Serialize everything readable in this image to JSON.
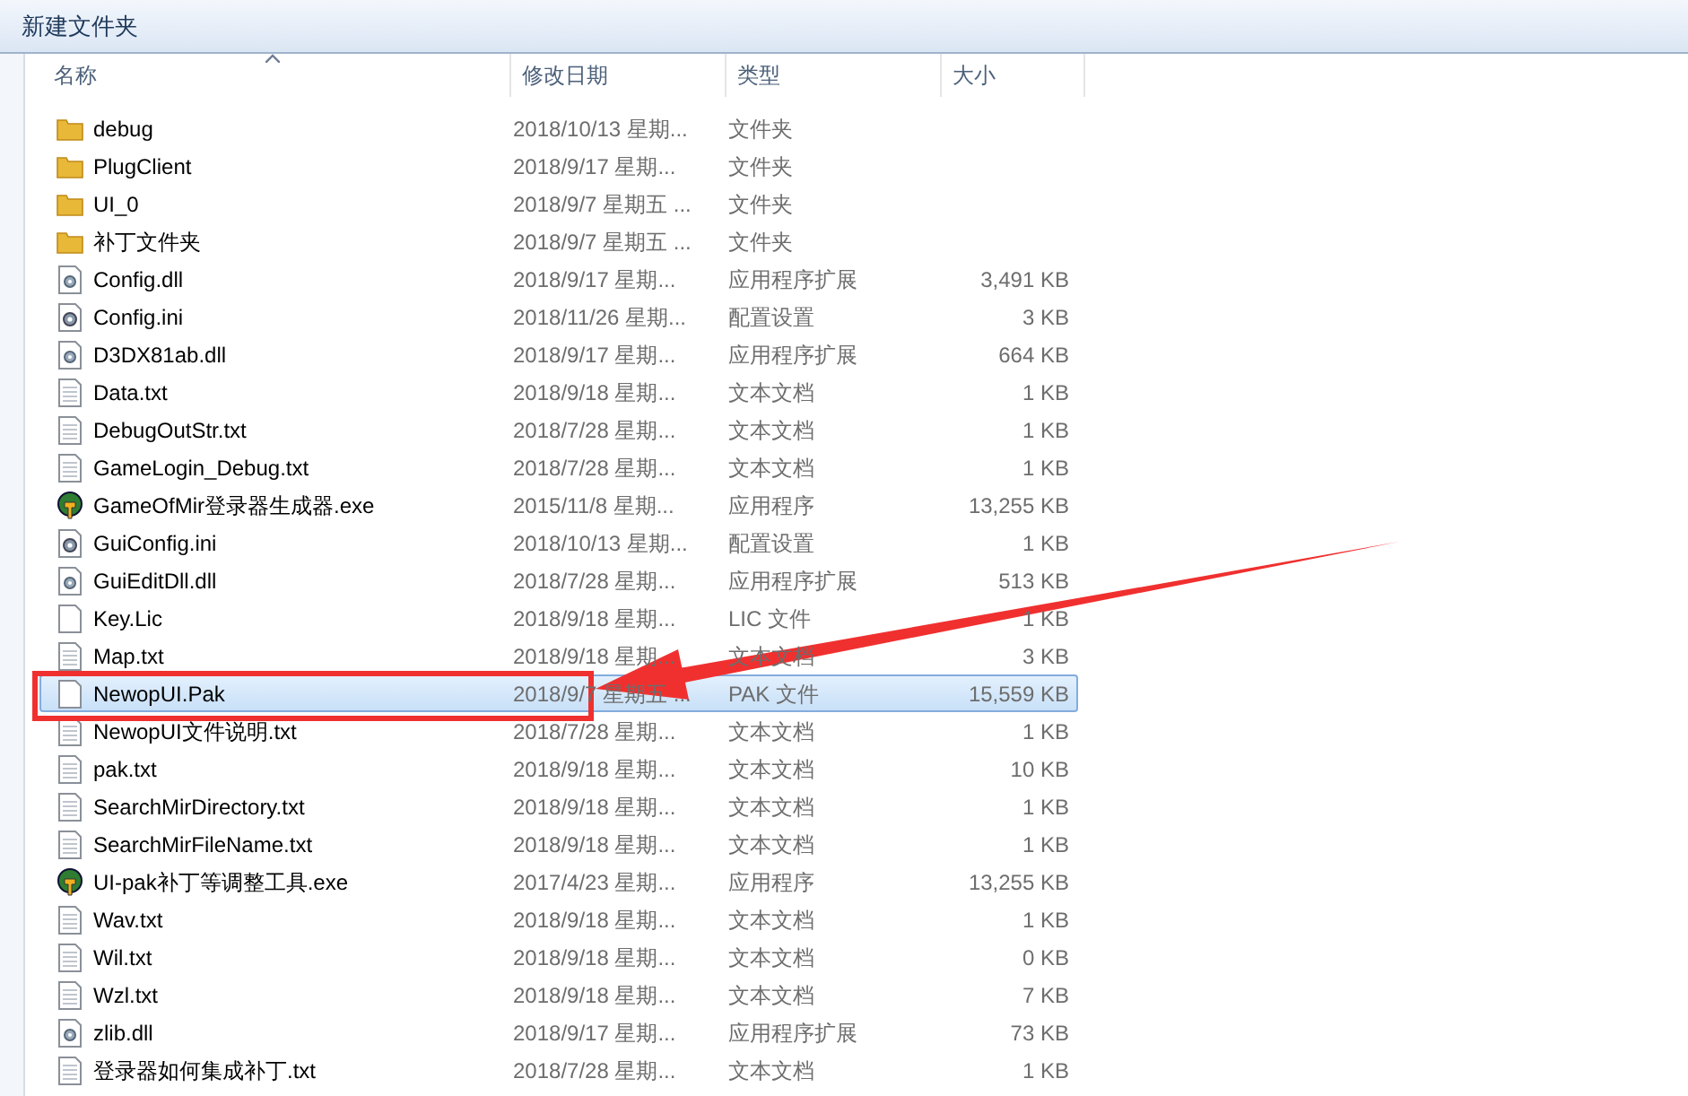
{
  "window": {
    "title": "新建文件夹"
  },
  "columns": [
    {
      "label": "名称",
      "sorted": true
    },
    {
      "label": "修改日期",
      "sorted": false
    },
    {
      "label": "类型",
      "sorted": false
    },
    {
      "label": "大小",
      "sorted": false
    }
  ],
  "files": [
    {
      "kind": "folder",
      "name": "debug",
      "date": "2018/10/13 星期...",
      "type": "文件夹",
      "selected": false
    },
    {
      "kind": "folder",
      "name": "PlugClient",
      "date": "2018/9/17 星期...",
      "type": "文件夹",
      "selected": false
    },
    {
      "kind": "folder",
      "name": "UI_0",
      "date": "2018/9/7 星期五 ...",
      "type": "文件夹",
      "selected": false
    },
    {
      "kind": "folder",
      "name": "补丁文件夹",
      "date": "2018/9/7 星期五 ...",
      "type": "文件夹",
      "selected": false
    },
    {
      "kind": "dll",
      "name": "Config.dll",
      "date": "2018/9/17 星期...",
      "type": "应用程序扩展",
      "size": "3,491 KB",
      "selected": false
    },
    {
      "kind": "ini",
      "name": "Config.ini",
      "date": "2018/11/26 星期...",
      "type": "配置设置",
      "size": "3 KB",
      "selected": false
    },
    {
      "kind": "dll",
      "name": "D3DX81ab.dll",
      "date": "2018/9/17 星期...",
      "type": "应用程序扩展",
      "size": "664 KB",
      "selected": false
    },
    {
      "kind": "text",
      "name": "Data.txt",
      "date": "2018/9/18 星期...",
      "type": "文本文档",
      "size": "1 KB",
      "selected": false
    },
    {
      "kind": "text",
      "name": "DebugOutStr.txt",
      "date": "2018/7/28 星期...",
      "type": "文本文档",
      "size": "1 KB",
      "selected": false
    },
    {
      "kind": "text",
      "name": "GameLogin_Debug.txt",
      "date": "2018/7/28 星期...",
      "type": "文本文档",
      "size": "1 KB",
      "selected": false
    },
    {
      "kind": "exe",
      "name": "GameOfMir登录器生成器.exe",
      "date": "2015/11/8 星期...",
      "type": "应用程序",
      "size": "13,255 KB",
      "selected": false
    },
    {
      "kind": "ini",
      "name": "GuiConfig.ini",
      "date": "2018/10/13 星期...",
      "type": "配置设置",
      "size": "1 KB",
      "selected": false
    },
    {
      "kind": "dll",
      "name": "GuiEditDll.dll",
      "date": "2018/7/28 星期...",
      "type": "应用程序扩展",
      "size": "513 KB",
      "selected": false
    },
    {
      "kind": "blank",
      "name": "Key.Lic",
      "date": "2018/9/18 星期...",
      "type": "LIC 文件",
      "size": "1 KB",
      "selected": false
    },
    {
      "kind": "text",
      "name": "Map.txt",
      "date": "2018/9/18 星期...",
      "type": "文本文档",
      "size": "3 KB",
      "selected": false
    },
    {
      "kind": "blank",
      "name": "NewopUI.Pak",
      "date": "2018/9/7 星期五 ...",
      "type": "PAK 文件",
      "size": "15,559 KB",
      "selected": true
    },
    {
      "kind": "text",
      "name": "NewopUI文件说明.txt",
      "date": "2018/7/28 星期...",
      "type": "文本文档",
      "size": "1 KB",
      "selected": false
    },
    {
      "kind": "text",
      "name": "pak.txt",
      "date": "2018/9/18 星期...",
      "type": "文本文档",
      "size": "10 KB",
      "selected": false
    },
    {
      "kind": "text",
      "name": "SearchMirDirectory.txt",
      "date": "2018/9/18 星期...",
      "type": "文本文档",
      "size": "1 KB",
      "selected": false
    },
    {
      "kind": "text",
      "name": "SearchMirFileName.txt",
      "date": "2018/9/18 星期...",
      "type": "文本文档",
      "size": "1 KB",
      "selected": false
    },
    {
      "kind": "exe",
      "name": "UI-pak补丁等调整工具.exe",
      "date": "2017/4/23 星期...",
      "type": "应用程序",
      "size": "13,255 KB",
      "selected": false
    },
    {
      "kind": "text",
      "name": "Wav.txt",
      "date": "2018/9/18 星期...",
      "type": "文本文档",
      "size": "1 KB",
      "selected": false
    },
    {
      "kind": "text",
      "name": "Wil.txt",
      "date": "2018/9/18 星期...",
      "type": "文本文档",
      "size": "0 KB",
      "selected": false
    },
    {
      "kind": "text",
      "name": "Wzl.txt",
      "date": "2018/9/18 星期...",
      "type": "文本文档",
      "size": "7 KB",
      "selected": false
    },
    {
      "kind": "dll",
      "name": "zlib.dll",
      "date": "2018/9/17 星期...",
      "type": "应用程序扩展",
      "size": "73 KB",
      "selected": false
    },
    {
      "kind": "text",
      "name": "登录器如何集成补丁.txt",
      "date": "2018/7/28 星期...",
      "type": "文本文档",
      "size": "1 KB",
      "selected": false
    }
  ]
}
